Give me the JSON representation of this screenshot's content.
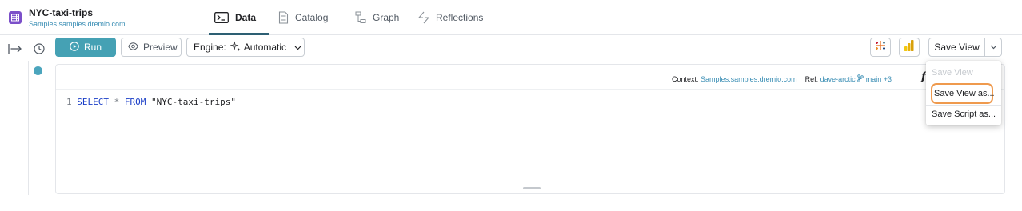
{
  "dataset": {
    "title": "NYC-taxi-trips",
    "path": "Samples.samples.dremio.com"
  },
  "tabs": [
    {
      "label": "Data",
      "icon": "terminal-icon",
      "active": true
    },
    {
      "label": "Catalog",
      "icon": "document-icon",
      "active": false
    },
    {
      "label": "Graph",
      "icon": "graph-icon",
      "active": false
    },
    {
      "label": "Reflections",
      "icon": "reflections-icon",
      "active": false
    }
  ],
  "toolbar": {
    "run_label": "Run",
    "preview_label": "Preview",
    "engine_label": "Engine:",
    "engine_value": "Automatic",
    "save_view_label": "Save View"
  },
  "editor": {
    "context_label": "Context:",
    "context_value": "Samples.samples.dremio.com",
    "ref_label": "Ref:",
    "ref_value": "dave-arctic",
    "branch_value": "main",
    "branch_extra": "+3",
    "fx_label": "f",
    "line_number": "1",
    "kw_select": "SELECT",
    "star": "*",
    "kw_from": "FROM",
    "table_literal": "\"NYC-taxi-trips\""
  },
  "save_menu": {
    "items": [
      {
        "label": "Save View",
        "disabled": true
      },
      {
        "label": "Save View as...",
        "highlighted": true
      },
      {
        "label": "Save Script as..."
      }
    ]
  },
  "colors": {
    "accent": "#45a1b4",
    "tab_underline": "#2d5f73",
    "link": "#3c8fb5",
    "highlight_border": "#ef9a4e",
    "dataset_icon": "#7b4fc9"
  }
}
